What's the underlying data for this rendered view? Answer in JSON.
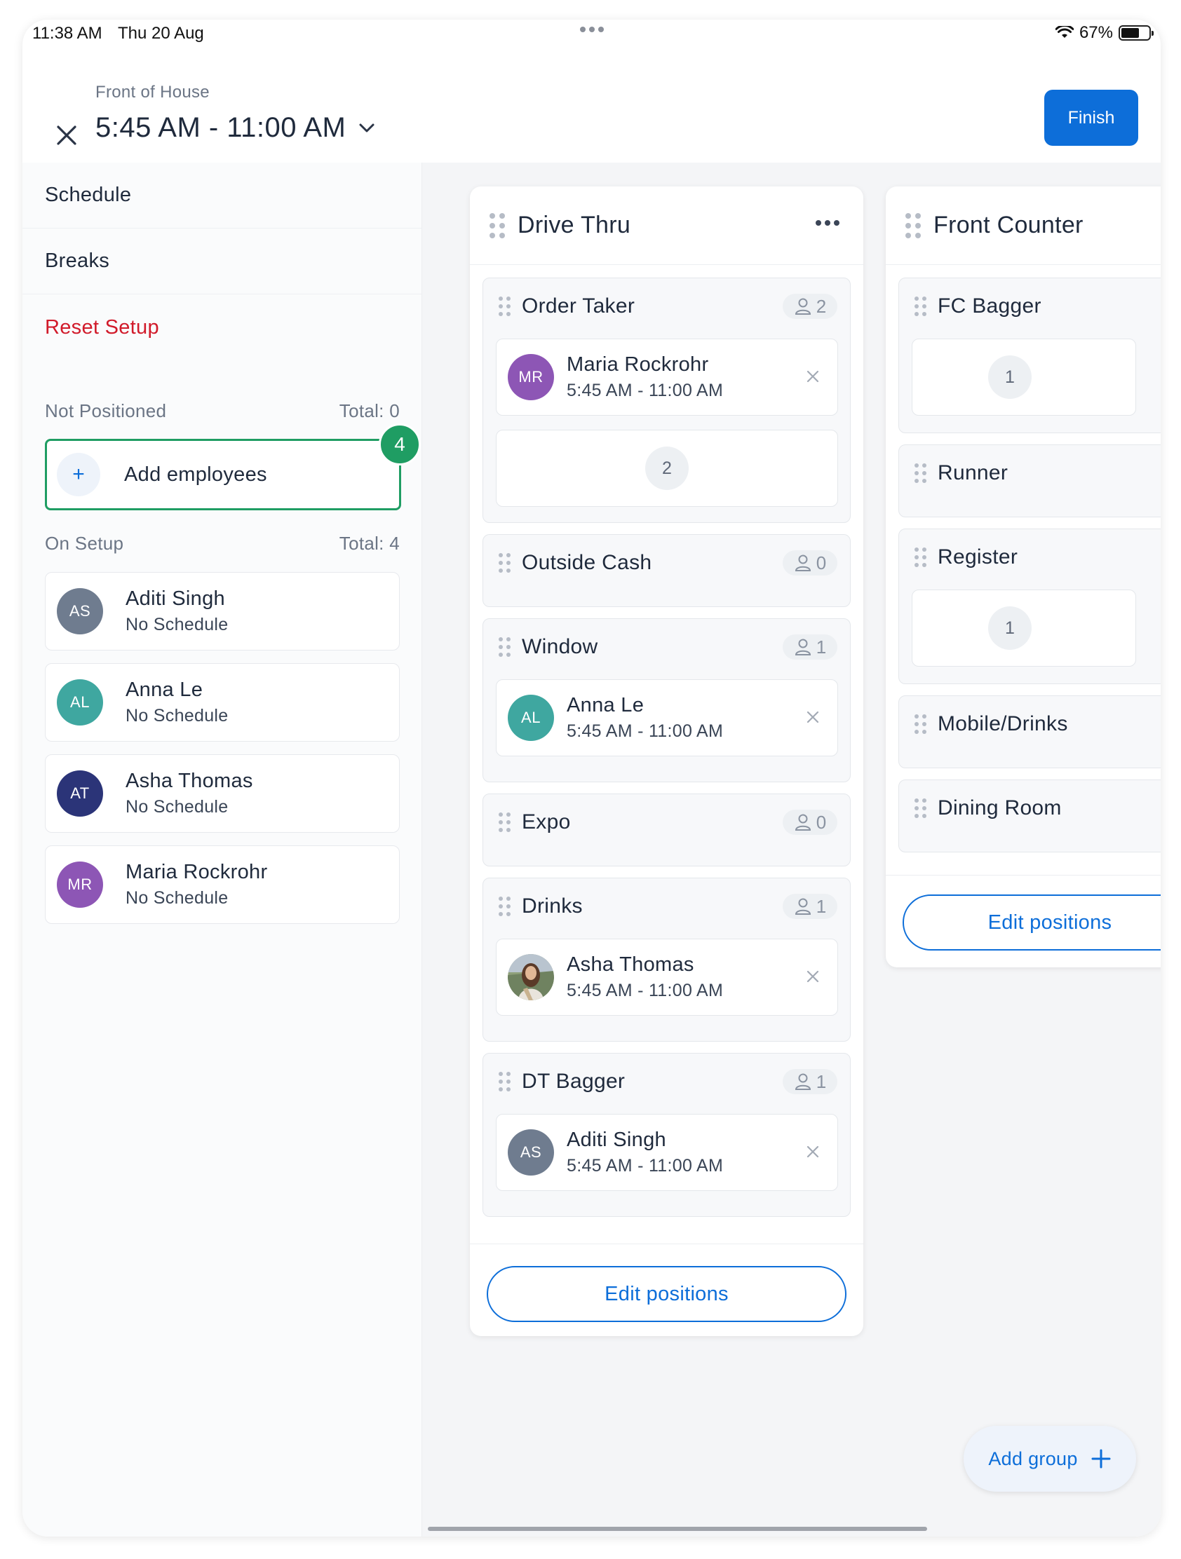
{
  "status_bar": {
    "time": "11:38 AM",
    "date": "Thu 20 Aug",
    "battery": "67%",
    "battery_level": 0.67
  },
  "header": {
    "subtitle": "Front of House",
    "title": "5:45 AM - 11:00 AM",
    "finish_label": "Finish"
  },
  "sidebar": {
    "menu": {
      "schedule": "Schedule",
      "breaks": "Breaks",
      "reset": "Reset Setup"
    },
    "not_positioned": {
      "label": "Not Positioned",
      "total": "Total: 0"
    },
    "add_employees": {
      "label": "Add employees",
      "badge": "4"
    },
    "on_setup": {
      "label": "On Setup",
      "total": "Total: 4",
      "employees": [
        {
          "initials": "AS",
          "name": "Aditi Singh",
          "status": "No Schedule",
          "color": "#6f7c8f"
        },
        {
          "initials": "AL",
          "name": "Anna Le",
          "status": "No Schedule",
          "color": "#3fa7a0"
        },
        {
          "initials": "AT",
          "name": "Asha Thomas",
          "status": "No Schedule",
          "color": "#2b3478"
        },
        {
          "initials": "MR",
          "name": "Maria Rockrohr",
          "status": "No Schedule",
          "color": "#8d56b5"
        }
      ]
    }
  },
  "groups": {
    "drive_thru": {
      "title": "Drive Thru",
      "positions": {
        "order_taker": {
          "title": "Order Taker",
          "count": "2",
          "assigned": {
            "initials": "MR",
            "name": "Maria Rockrohr",
            "time": "5:45 AM - 11:00 AM",
            "color": "#8d56b5"
          },
          "empty_slot": "2"
        },
        "outside_cash": {
          "title": "Outside Cash",
          "count": "0"
        },
        "window": {
          "title": "Window",
          "count": "1",
          "assigned": {
            "initials": "AL",
            "name": "Anna Le",
            "time": "5:45 AM - 11:00 AM",
            "color": "#3fa7a0"
          }
        },
        "expo": {
          "title": "Expo",
          "count": "0"
        },
        "drinks": {
          "title": "Drinks",
          "count": "1",
          "assigned": {
            "name": "Asha Thomas",
            "time": "5:45 AM - 11:00 AM",
            "photo": true
          }
        },
        "dt_bagger": {
          "title": "DT Bagger",
          "count": "1",
          "assigned": {
            "initials": "AS",
            "name": "Aditi Singh",
            "time": "5:45 AM - 11:00 AM",
            "color": "#6f7c8f"
          }
        }
      },
      "edit_label": "Edit positions"
    },
    "front_counter": {
      "title": "Front Counter",
      "positions": {
        "fc_bagger": {
          "title": "FC Bagger",
          "empty_slot": "1"
        },
        "runner": {
          "title": "Runner"
        },
        "register": {
          "title": "Register",
          "empty_slot": "1"
        },
        "mobile_drinks": {
          "title": "Mobile/Drinks"
        },
        "dining_room": {
          "title": "Dining Room"
        }
      },
      "edit_label": "Edit positions"
    }
  },
  "add_group_label": "Add group",
  "colors": {
    "accent": "#0d6ed9",
    "success": "#1f9d63",
    "danger": "#d11a2a"
  }
}
